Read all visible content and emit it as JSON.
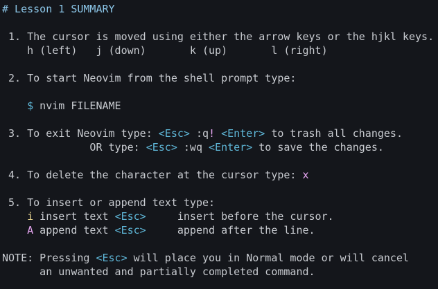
{
  "heading": "# Lesson 1 SUMMARY",
  "item1": {
    "line1": " 1. The cursor is moved using either the arrow keys or the hjkl keys.",
    "line2": "    h (left)   j (down)       k (up)       l (right)"
  },
  "item2": {
    "line1": " 2. To start Neovim from the shell prompt type:",
    "prompt_indent": "    ",
    "prompt_symbol": "$",
    "command": " nvim FILENAME"
  },
  "item3": {
    "line1_prefix": " 3. To exit Neovim type: ",
    "esc": "<Esc>",
    "quit_cmd_pre": " :q",
    "bang": "!",
    "space": " ",
    "enter": "<Enter>",
    "trash_text": " to trash all changes.",
    "line2_prefix": "              OR type: ",
    "write_cmd": " :wq ",
    "save_text": " to save the changes."
  },
  "item4": {
    "line1_prefix": " 4. To delete the character at the cursor type: ",
    "key": "x"
  },
  "item5": {
    "line1": " 5. To insert or append text type:",
    "indent": "    ",
    "insert_key": "i",
    "insert_label": " insert text ",
    "esc": "<Esc>",
    "insert_desc": "     insert before the cursor.",
    "append_key": "A",
    "append_label": " append text ",
    "append_desc": "     append after the line."
  },
  "note": {
    "prefix": "NOTE: Pressing ",
    "esc": "<Esc>",
    "line1_rest": " will place you in Normal mode or will cancel",
    "line2": "      an unwanted and partially completed command."
  }
}
